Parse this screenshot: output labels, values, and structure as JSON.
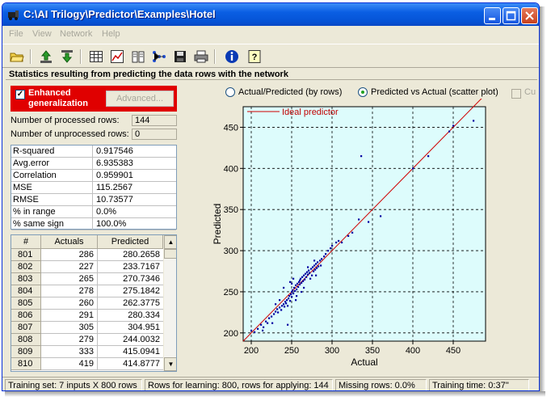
{
  "window": {
    "title": "C:\\AI Trilogy\\Predictor\\Examples\\Hotel"
  },
  "menu": [
    "File",
    "View",
    "Network",
    "Help"
  ],
  "toolbar_icons": [
    "open-folder-icon",
    "upload-icon",
    "download-icon",
    "grid-icon",
    "chart-icon",
    "book-icon",
    "network-icon",
    "save-icon",
    "print-icon",
    "info-icon",
    "help-icon"
  ],
  "heading": "Statistics resulting from predicting the data rows with the network",
  "enhanced": {
    "label": "Enhanced generalization",
    "checked": true,
    "advanced_label": "Advanced..."
  },
  "processed": {
    "label": "Number of processed rows:",
    "value": "144"
  },
  "unprocessed": {
    "label": "Number of unprocessed rows:",
    "value": "0"
  },
  "stats": [
    {
      "k": "R-squared",
      "v": "0.917546"
    },
    {
      "k": "Avg.error",
      "v": "6.935383"
    },
    {
      "k": "Correlation",
      "v": "0.959901"
    },
    {
      "k": "MSE",
      "v": "115.2567"
    },
    {
      "k": "RMSE",
      "v": "10.73577"
    },
    {
      "k": "% in range",
      "v": "0.0%"
    },
    {
      "k": "% same sign",
      "v": "100.0%"
    }
  ],
  "table": {
    "headers": [
      "#",
      "Actuals",
      "Predicted"
    ],
    "rows": [
      [
        "801",
        "286",
        "280.2658"
      ],
      [
        "802",
        "227",
        "233.7167"
      ],
      [
        "803",
        "265",
        "270.7346"
      ],
      [
        "804",
        "278",
        "275.1842"
      ],
      [
        "805",
        "260",
        "262.3775"
      ],
      [
        "806",
        "291",
        "280.334"
      ],
      [
        "807",
        "305",
        "304.951"
      ],
      [
        "808",
        "279",
        "244.0032"
      ],
      [
        "809",
        "333",
        "415.0941"
      ],
      [
        "810",
        "419",
        "414.8777"
      ]
    ]
  },
  "view_options": {
    "actual_predicted": "Actual/Predicted (by rows)",
    "scatter": "Predicted vs Actual (scatter plot)",
    "cumulative": "Cu"
  },
  "chart_data": {
    "type": "scatter",
    "legend": "Ideal predictor",
    "legend_placement": "top-left",
    "xlabel": "Actual",
    "ylabel": "Predicted",
    "xlim": [
      190,
      490
    ],
    "ylim": [
      190,
      475
    ],
    "xticks": [
      200,
      250,
      300,
      350,
      400,
      450
    ],
    "yticks": [
      200,
      250,
      300,
      350,
      400,
      450
    ],
    "grid": true,
    "ideal_line": [
      [
        190,
        190
      ],
      [
        490,
        490
      ]
    ],
    "points": [
      [
        200,
        203
      ],
      [
        204,
        201
      ],
      [
        208,
        205
      ],
      [
        212,
        210
      ],
      [
        215,
        207
      ],
      [
        218,
        214
      ],
      [
        220,
        212
      ],
      [
        222,
        218
      ],
      [
        225,
        220
      ],
      [
        228,
        223
      ],
      [
        230,
        226
      ],
      [
        232,
        229
      ],
      [
        233,
        225
      ],
      [
        235,
        231
      ],
      [
        237,
        228
      ],
      [
        238,
        233
      ],
      [
        240,
        235
      ],
      [
        241,
        232
      ],
      [
        242,
        238
      ],
      [
        243,
        236
      ],
      [
        244,
        240
      ],
      [
        245,
        233
      ],
      [
        246,
        242
      ],
      [
        247,
        245
      ],
      [
        248,
        239
      ],
      [
        249,
        247
      ],
      [
        250,
        244
      ],
      [
        250,
        250
      ],
      [
        251,
        252
      ],
      [
        252,
        248
      ],
      [
        253,
        255
      ],
      [
        254,
        251
      ],
      [
        255,
        258
      ],
      [
        256,
        253
      ],
      [
        257,
        260
      ],
      [
        258,
        256
      ],
      [
        259,
        262
      ],
      [
        260,
        259
      ],
      [
        260,
        264
      ],
      [
        261,
        266
      ],
      [
        262,
        261
      ],
      [
        263,
        268
      ],
      [
        264,
        263
      ],
      [
        265,
        270
      ],
      [
        266,
        265
      ],
      [
        267,
        272
      ],
      [
        268,
        268
      ],
      [
        269,
        274
      ],
      [
        270,
        271
      ],
      [
        271,
        276
      ],
      [
        272,
        273
      ],
      [
        273,
        266
      ],
      [
        274,
        278
      ],
      [
        275,
        270
      ],
      [
        276,
        280
      ],
      [
        277,
        275
      ],
      [
        278,
        282
      ],
      [
        279,
        277
      ],
      [
        280,
        284
      ],
      [
        281,
        279
      ],
      [
        282,
        286
      ],
      [
        283,
        281
      ],
      [
        285,
        288
      ],
      [
        286,
        282
      ],
      [
        287,
        290
      ],
      [
        290,
        293
      ],
      [
        292,
        296
      ],
      [
        295,
        300
      ],
      [
        298,
        303
      ],
      [
        300,
        306
      ],
      [
        305,
        310
      ],
      [
        308,
        312
      ],
      [
        312,
        310
      ],
      [
        320,
        318
      ],
      [
        325,
        322
      ],
      [
        333,
        338
      ],
      [
        336,
        415
      ],
      [
        345,
        335
      ],
      [
        360,
        342
      ],
      [
        400,
        400
      ],
      [
        419,
        415
      ],
      [
        445,
        445
      ],
      [
        450,
        452
      ],
      [
        475,
        458
      ],
      [
        245,
        210
      ],
      [
        250,
        260
      ],
      [
        255,
        240
      ],
      [
        240,
        255
      ],
      [
        265,
        255
      ],
      [
        270,
        280
      ],
      [
        262,
        250
      ],
      [
        248,
        262
      ],
      [
        235,
        240
      ],
      [
        230,
        235
      ],
      [
        280,
        270
      ],
      [
        278,
        288
      ],
      [
        226,
        212
      ],
      [
        214,
        203
      ],
      [
        256,
        245
      ],
      [
        252,
        266
      ]
    ]
  },
  "status": [
    "Training set: 7 inputs X 800 rows",
    "Rows for learning: 800, rows for applying: 144",
    "Missing rows: 0.0%",
    "Training time: 0:37''"
  ]
}
